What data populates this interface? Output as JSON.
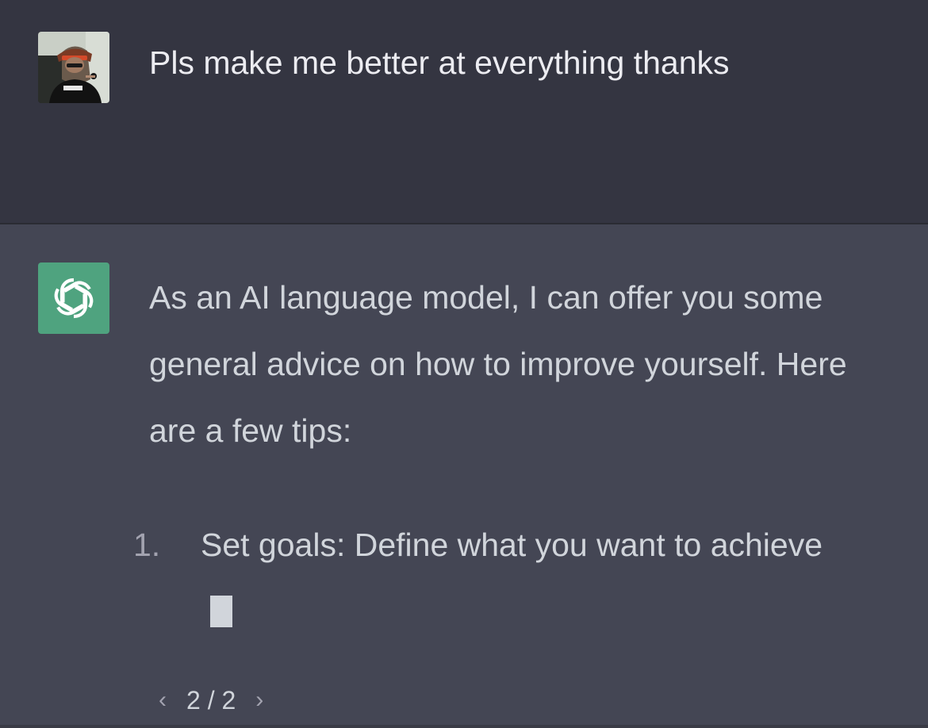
{
  "user_message": {
    "avatar_icon": "user-photo-avatar",
    "text": "Pls make me better at everything thanks"
  },
  "assistant_message": {
    "avatar_icon": "openai-logo-icon",
    "avatar_color": "#4fa37f",
    "paragraph": "As an AI language model, I can offer you some general advice on how to improve yourself. Here are a few tips:",
    "list": [
      {
        "number": "1.",
        "text": "Set goals: Define what you want to achieve"
      }
    ]
  },
  "pager": {
    "prev_icon": "chevron-left-icon",
    "label": "2 / 2",
    "next_icon": "chevron-right-icon"
  },
  "colors": {
    "user_bg": "#343541",
    "assistant_bg": "#444654",
    "text": "#d1d5db"
  }
}
